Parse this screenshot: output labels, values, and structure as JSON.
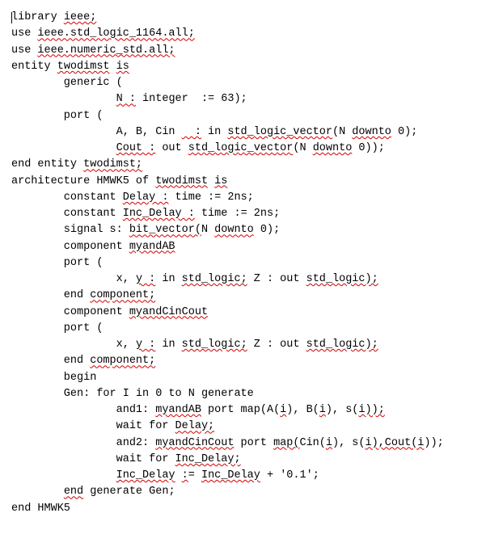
{
  "lines": [
    {
      "ind": 0,
      "segs": [
        {
          "t": "",
          "cur": true
        },
        {
          "t": "library "
        },
        {
          "t": "ieee;",
          "sq": true
        }
      ]
    },
    {
      "ind": 0,
      "segs": [
        {
          "t": "use "
        },
        {
          "t": "ieee.std_logic_1164.all;",
          "u": true
        }
      ]
    },
    {
      "ind": 0,
      "segs": [
        {
          "t": "use "
        },
        {
          "t": "ieee.numeric_std.all;",
          "sq": true
        }
      ]
    },
    {
      "ind": 0,
      "segs": [
        {
          "t": ""
        }
      ]
    },
    {
      "ind": 0,
      "segs": [
        {
          "t": "entity "
        },
        {
          "t": "twodimst",
          "sq": true
        },
        {
          "t": " "
        },
        {
          "t": "is",
          "u": true
        }
      ]
    },
    {
      "ind": 8,
      "segs": [
        {
          "t": "generic ("
        }
      ]
    },
    {
      "ind": 16,
      "segs": [
        {
          "t": "N :",
          "u": true
        },
        {
          "t": " integer  := 63);"
        }
      ]
    },
    {
      "ind": 0,
      "segs": [
        {
          "t": ""
        }
      ]
    },
    {
      "ind": 8,
      "segs": [
        {
          "t": "port ("
        }
      ]
    },
    {
      "ind": 16,
      "segs": [
        {
          "t": "A, B, Cin "
        },
        {
          "t": "  :",
          "u": true
        },
        {
          "t": " in "
        },
        {
          "t": "std_logic_vector",
          "sq": true
        },
        {
          "t": "(N "
        },
        {
          "t": "downto",
          "sq": true
        },
        {
          "t": " 0);"
        }
      ]
    },
    {
      "ind": 16,
      "segs": [
        {
          "t": "Cout :",
          "sq": true
        },
        {
          "t": " out "
        },
        {
          "t": "std_logic_vector",
          "sq": true
        },
        {
          "t": "(N "
        },
        {
          "t": "downto",
          "sq": true
        },
        {
          "t": " 0));"
        }
      ]
    },
    {
      "ind": 0,
      "segs": [
        {
          "t": "end entity "
        },
        {
          "t": "twodimst;",
          "sq": true
        }
      ]
    },
    {
      "ind": 0,
      "segs": [
        {
          "t": ""
        }
      ]
    },
    {
      "ind": 0,
      "segs": [
        {
          "t": "architecture HMWK5 of "
        },
        {
          "t": "twodimst",
          "sq": true
        },
        {
          "t": " "
        },
        {
          "t": "is",
          "u": true
        }
      ]
    },
    {
      "ind": 8,
      "segs": [
        {
          "t": "constant "
        },
        {
          "t": "Delay :",
          "u": true
        },
        {
          "t": " time := 2ns;"
        }
      ]
    },
    {
      "ind": 8,
      "segs": [
        {
          "t": "constant "
        },
        {
          "t": "Inc_Delay :",
          "sq": true
        },
        {
          "t": " time := 2ns;"
        }
      ]
    },
    {
      "ind": 8,
      "segs": [
        {
          "t": "signal s: "
        },
        {
          "t": "bit_vector(",
          "sq": true
        },
        {
          "t": "N "
        },
        {
          "t": "downto",
          "sq": true
        },
        {
          "t": " 0);"
        }
      ]
    },
    {
      "ind": 0,
      "segs": [
        {
          "t": ""
        }
      ]
    },
    {
      "ind": 8,
      "segs": [
        {
          "t": "component "
        },
        {
          "t": "myandAB",
          "sq": true
        }
      ]
    },
    {
      "ind": 8,
      "segs": [
        {
          "t": "port ("
        }
      ]
    },
    {
      "ind": 16,
      "segs": [
        {
          "t": "x, "
        },
        {
          "t": "y :",
          "u": true
        },
        {
          "t": " in "
        },
        {
          "t": "std_logic;",
          "sq": true
        },
        {
          "t": " Z : out "
        },
        {
          "t": "std_logic);",
          "sq": true
        }
      ]
    },
    {
      "ind": 8,
      "segs": [
        {
          "t": "end "
        },
        {
          "t": "component;",
          "u": true
        }
      ]
    },
    {
      "ind": 0,
      "segs": [
        {
          "t": ""
        }
      ]
    },
    {
      "ind": 8,
      "segs": [
        {
          "t": "component "
        },
        {
          "t": "myandCinCout",
          "sq": true
        }
      ]
    },
    {
      "ind": 8,
      "segs": [
        {
          "t": "port ("
        }
      ]
    },
    {
      "ind": 16,
      "segs": [
        {
          "t": "x, "
        },
        {
          "t": "y :",
          "u": true
        },
        {
          "t": " in "
        },
        {
          "t": "std_logic;",
          "sq": true
        },
        {
          "t": " Z : out "
        },
        {
          "t": "std_logic);",
          "sq": true
        }
      ]
    },
    {
      "ind": 8,
      "segs": [
        {
          "t": "end "
        },
        {
          "t": "component;",
          "u": true
        }
      ]
    },
    {
      "ind": 0,
      "segs": [
        {
          "t": ""
        }
      ]
    },
    {
      "ind": 8,
      "segs": [
        {
          "t": "begin"
        }
      ]
    },
    {
      "ind": 8,
      "segs": [
        {
          "t": "Gen: for I in 0 to N generate"
        }
      ]
    },
    {
      "ind": 16,
      "segs": [
        {
          "t": "and1: "
        },
        {
          "t": "myandAB",
          "sq": true
        },
        {
          "t": " port map(A("
        },
        {
          "t": "i",
          "sq": true
        },
        {
          "t": "), B("
        },
        {
          "t": "i",
          "sq": true
        },
        {
          "t": "), s("
        },
        {
          "t": "i));",
          "sq": true
        }
      ]
    },
    {
      "ind": 16,
      "segs": [
        {
          "t": "wait for "
        },
        {
          "t": "Delay;",
          "u": true
        }
      ]
    },
    {
      "ind": 16,
      "segs": [
        {
          "t": "and2: "
        },
        {
          "t": "myandCinCout",
          "sq": true
        },
        {
          "t": " port "
        },
        {
          "t": "map(",
          "u": true
        },
        {
          "t": "Cin("
        },
        {
          "t": "i",
          "sq": true
        },
        {
          "t": "), s("
        },
        {
          "t": "i),Cout(i",
          "sq": true
        },
        {
          "t": "));"
        }
      ]
    },
    {
      "ind": 16,
      "segs": [
        {
          "t": "wait for "
        },
        {
          "t": "Inc_Delay;",
          "sq": true
        }
      ]
    },
    {
      "ind": 16,
      "segs": [
        {
          "t": "Inc_Delay",
          "sq": true
        },
        {
          "t": " "
        },
        {
          "t": ":",
          "u": true
        },
        {
          "t": "= "
        },
        {
          "t": "Inc_Delay",
          "sq": true
        },
        {
          "t": " + '0.1';"
        }
      ]
    },
    {
      "ind": 8,
      "segs": [
        {
          "t": "end",
          "u": true
        },
        {
          "t": " generate Gen;"
        }
      ]
    },
    {
      "ind": 0,
      "segs": [
        {
          "t": "end HMWK5"
        }
      ]
    }
  ]
}
